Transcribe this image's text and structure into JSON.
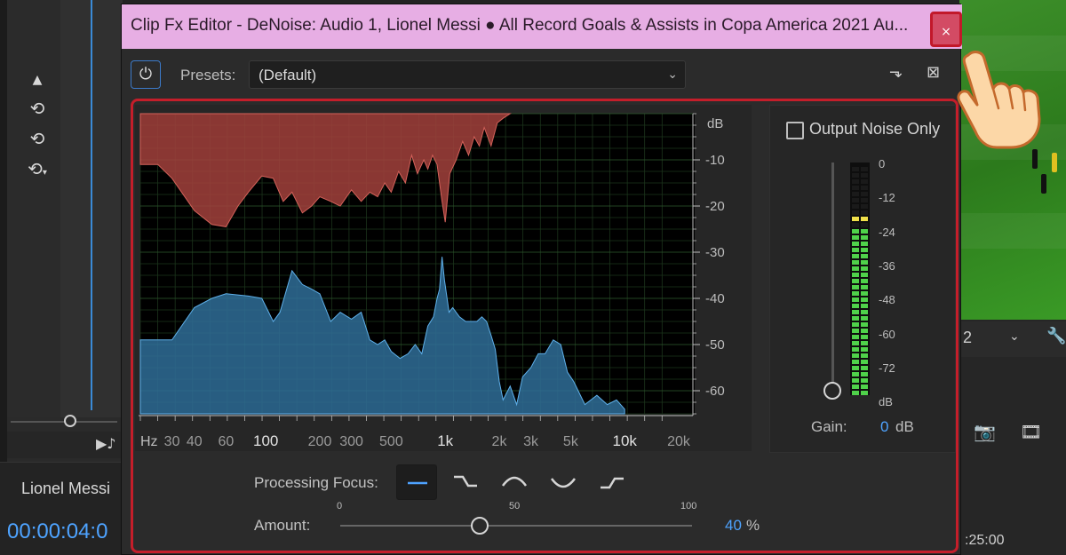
{
  "background": {
    "track_name": "Lionel  Messi",
    "timecode": "00:00:04:0",
    "right_num": "2",
    "right_time": ":25:00"
  },
  "dialog": {
    "title": "Clip Fx Editor - DeNoise: Audio 1, Lionel Messi ● All Record Goals & Assists in Copa America 2021 Au...",
    "close_label": "×"
  },
  "toolbar": {
    "presets_label": "Presets:",
    "presets_value": "(Default)"
  },
  "graph": {
    "db_unit": "dB",
    "db_ticks": [
      "-10",
      "-20",
      "-30",
      "-40",
      "-50",
      "-60"
    ],
    "hz_unit": "Hz",
    "hz_ticks": [
      "30",
      "40",
      "60",
      "100",
      "200",
      "300",
      "500",
      "1k",
      "2k",
      "3k",
      "5k",
      "10k",
      "20k"
    ]
  },
  "meter": {
    "output_noise_label": "Output Noise Only",
    "output_noise_checked": false,
    "scale": [
      "0",
      "-12",
      "-24",
      "-36",
      "-48",
      "-60",
      "-72",
      "dB"
    ],
    "gain_label": "Gain:",
    "gain_value": "0",
    "gain_unit": "dB"
  },
  "processing": {
    "focus_label": "Processing Focus:",
    "focus_options": [
      "flat",
      "low-shelf",
      "mid-bump",
      "mid-dip",
      "high-shelf"
    ],
    "focus_selected": "flat",
    "amount_label": "Amount:",
    "amount_ticks": [
      "0",
      "50",
      "100"
    ],
    "amount_value": "40",
    "amount_unit": "%"
  },
  "colors": {
    "accent": "#4ea3ff",
    "titlebar": "#e7aee4",
    "highlight_frame": "#c41e2a",
    "noise_fill": "#a2413c",
    "signal_fill": "#2f6d98"
  }
}
